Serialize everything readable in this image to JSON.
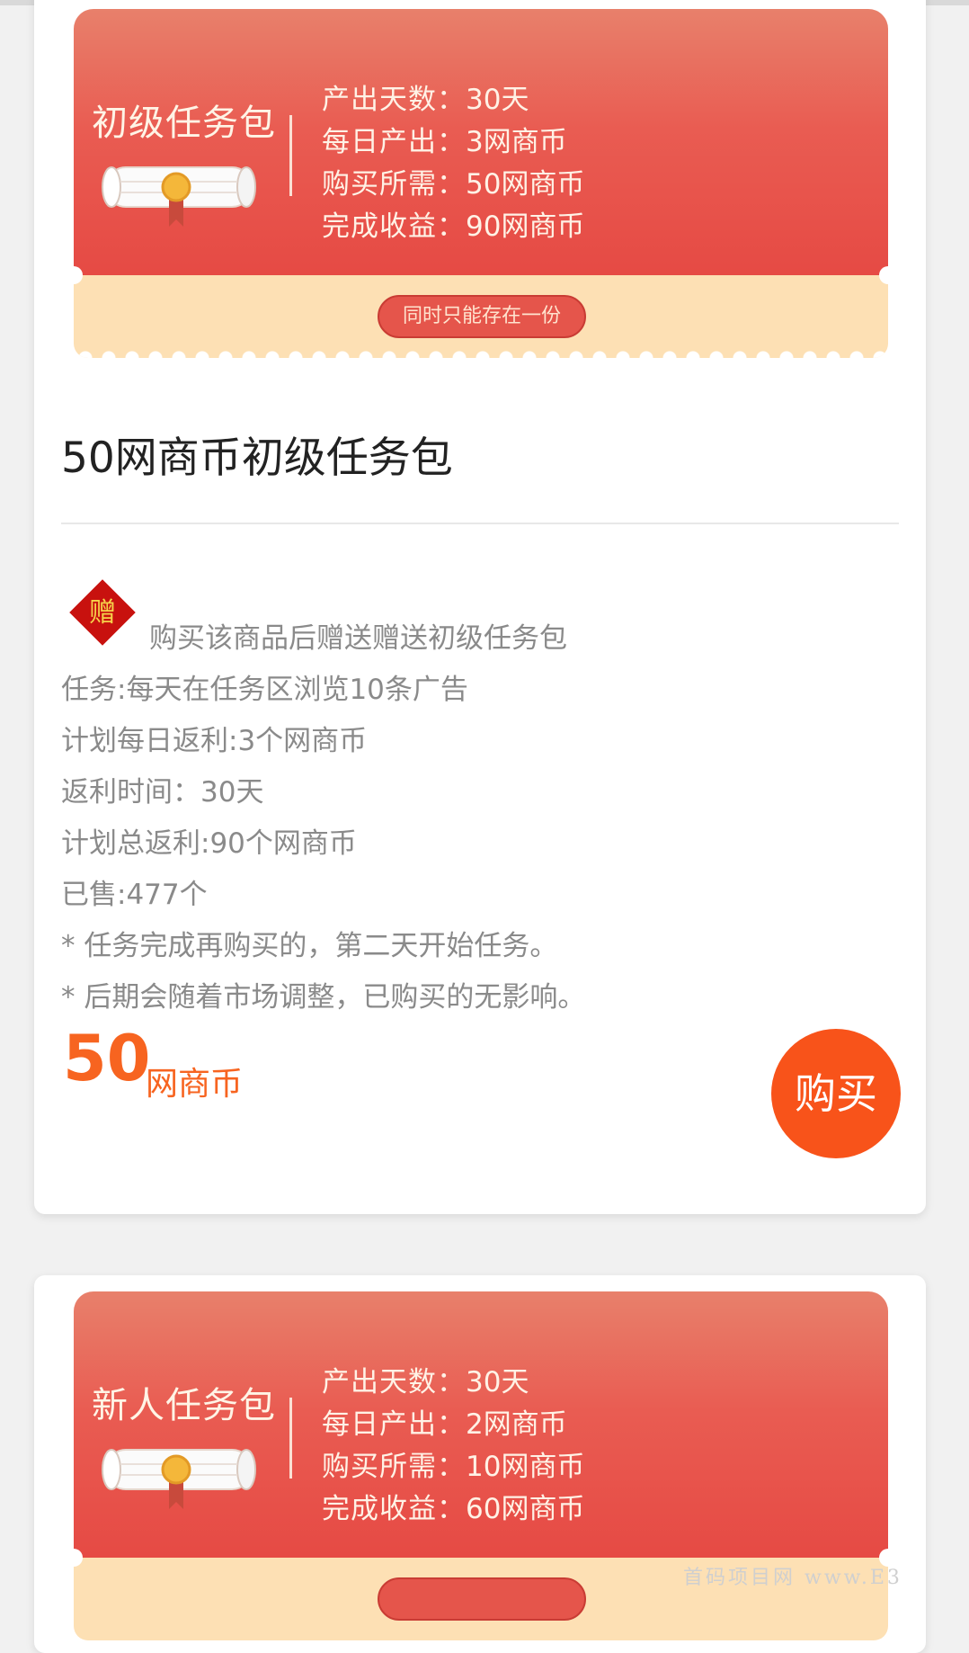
{
  "colors": {
    "banner_red": "#e95c52",
    "banner_cream": "#fde0b4",
    "accent_orange": "#f76420",
    "buy_button": "#f8531a",
    "text_gray": "#8a8a8a"
  },
  "packages": [
    {
      "name": "初级任务包",
      "info": [
        {
          "key": "产出天数：",
          "value": "30天"
        },
        {
          "key": "每日产出：",
          "value": "3网商币"
        },
        {
          "key": "购买所需：",
          "value": "50网商币"
        },
        {
          "key": "完成收益：",
          "value": "90网商币"
        }
      ],
      "pill": "同时只能存在一份",
      "title": "50网商币初级任务包",
      "gift_char": "赠",
      "desc": [
        "购买该商品后赠送赠送初级任务包",
        "任务:每天在任务区浏览10条广告",
        "计划每日返利:3个网商币",
        "返利时间：30天",
        "计划总返利:90个网商币",
        "已售:477个",
        "* 任务完成再购买的，第二天开始任务。",
        "* 后期会随着市场调整，已购买的无影响。"
      ],
      "price": "50",
      "price_unit": "网商币",
      "buy_label": "购买"
    },
    {
      "name": "新人任务包",
      "info": [
        {
          "key": "产出天数：",
          "value": "30天"
        },
        {
          "key": "每日产出：",
          "value": "2网商币"
        },
        {
          "key": "购买所需：",
          "value": "10网商币"
        },
        {
          "key": "完成收益：",
          "value": "60网商币"
        }
      ]
    }
  ],
  "watermark": "首码项目网 www.E3"
}
